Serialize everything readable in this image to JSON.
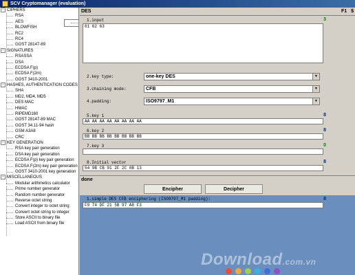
{
  "window": {
    "title": "SCV Cryptomanager (evaluation)"
  },
  "tree": [
    {
      "type": "cat",
      "label": "CIPHERS",
      "sign": "−"
    },
    {
      "type": "item",
      "label": "RSA"
    },
    {
      "type": "item",
      "label": "DES",
      "selected": true
    },
    {
      "type": "item",
      "label": "AES"
    },
    {
      "type": "item",
      "label": "BLOWFISH"
    },
    {
      "type": "item",
      "label": "RC2"
    },
    {
      "type": "item",
      "label": "RC4"
    },
    {
      "type": "item",
      "label": "GOST 28147-89"
    },
    {
      "type": "cat",
      "label": "SIGNATURES",
      "sign": "−"
    },
    {
      "type": "item",
      "label": "RSASSA"
    },
    {
      "type": "item",
      "label": "DSA"
    },
    {
      "type": "item",
      "label": "ECDSA F(p)"
    },
    {
      "type": "item",
      "label": "ECDSA F(2m)"
    },
    {
      "type": "item",
      "label": "GOST 3410-2001"
    },
    {
      "type": "cat",
      "label": "HASHES, AUTHENTICATION CODES",
      "sign": "−"
    },
    {
      "type": "item",
      "label": "SHA"
    },
    {
      "type": "item",
      "label": "MD2, MD4, MD5"
    },
    {
      "type": "item",
      "label": "DES MAC"
    },
    {
      "type": "item",
      "label": "HMAC"
    },
    {
      "type": "item",
      "label": "RIPEMD160"
    },
    {
      "type": "item",
      "label": "GOST 28147-89 MAC"
    },
    {
      "type": "item",
      "label": "GOST 34.11-94 hash"
    },
    {
      "type": "item",
      "label": "GSM A3A8"
    },
    {
      "type": "item",
      "label": "CRC"
    },
    {
      "type": "cat",
      "label": "KEY GENERATION",
      "sign": "−"
    },
    {
      "type": "item",
      "label": "RSA key pair generation"
    },
    {
      "type": "item",
      "label": "DSA key pair generation"
    },
    {
      "type": "item",
      "label": "ECDSA F(p) key pair generation"
    },
    {
      "type": "item",
      "label": "ECDSA F(2m) key pair generation"
    },
    {
      "type": "item",
      "label": "GOST 3410-2001 key generation"
    },
    {
      "type": "cat",
      "label": "MISCELLANEOUS",
      "sign": "−"
    },
    {
      "type": "item",
      "label": "Modular arithmetics calculator"
    },
    {
      "type": "item",
      "label": "Prime number generator"
    },
    {
      "type": "item",
      "label": "Random number generator"
    },
    {
      "type": "item",
      "label": "Reverse octet string"
    },
    {
      "type": "item",
      "label": "Convert integer to octet string"
    },
    {
      "type": "item",
      "label": "Convert octet string to integer"
    },
    {
      "type": "item",
      "label": "Store ASCII to binary file"
    },
    {
      "type": "item",
      "label": "Load ASCII from binary file"
    }
  ],
  "panel": {
    "title": "DES",
    "fkey_help": "F1",
    "fkey_currency": "$",
    "input": {
      "label": "1.input",
      "value": "61 62 63",
      "count": "3"
    },
    "key_type": {
      "label": "2.key type:",
      "value": "one-key DES"
    },
    "chaining": {
      "label": "3.chaining mode:",
      "value": "CFB"
    },
    "padding": {
      "label": "4.padding:",
      "value": "ISO9797_M1"
    },
    "key1": {
      "label": "5.key 1",
      "value": "AA AA AA AA AA AA AA AA",
      "count": "8"
    },
    "key2": {
      "label": "6.key 2",
      "value": "BB BB BB BB BB BB BB BB",
      "count": "8"
    },
    "key3": {
      "label": "7.key 3",
      "value": "",
      "count": "0"
    },
    "iv": {
      "label": "8.Initial vector",
      "value": "54 9B CB 91 2F 2C 0B 13",
      "count": "8"
    },
    "status": "done",
    "encipher_label": "Encipher",
    "decipher_label": "Decipher"
  },
  "output": {
    "label": "1.simple DES CFB enciphering (ISO9797_M1 padding):",
    "value": "F9 74 DF 21 5B 97 A8 F3",
    "count": "8"
  },
  "watermark": {
    "text": "Download",
    "tld": ".com.vn"
  },
  "colors": {
    "selection": "#0a246a",
    "output_bg": "#6a8fbe",
    "count_green": "#008000",
    "count_blue": "#002a80"
  }
}
